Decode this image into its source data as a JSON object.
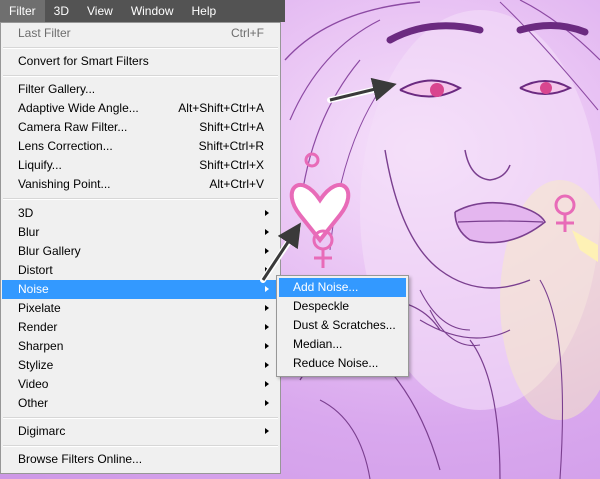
{
  "menubar": {
    "items": [
      "Filter",
      "3D",
      "View",
      "Window",
      "Help"
    ]
  },
  "filter_menu": {
    "last_filter": {
      "label": "Last Filter",
      "shortcut": "Ctrl+F"
    },
    "convert": "Convert for Smart Filters",
    "group1": [
      {
        "label": "Filter Gallery...",
        "shortcut": ""
      },
      {
        "label": "Adaptive Wide Angle...",
        "shortcut": "Alt+Shift+Ctrl+A"
      },
      {
        "label": "Camera Raw Filter...",
        "shortcut": "Shift+Ctrl+A"
      },
      {
        "label": "Lens Correction...",
        "shortcut": "Shift+Ctrl+R"
      },
      {
        "label": "Liquify...",
        "shortcut": "Shift+Ctrl+X"
      },
      {
        "label": "Vanishing Point...",
        "shortcut": "Alt+Ctrl+V"
      }
    ],
    "submenus": [
      "3D",
      "Blur",
      "Blur Gallery",
      "Distort",
      "Noise",
      "Pixelate",
      "Render",
      "Sharpen",
      "Stylize",
      "Video",
      "Other"
    ],
    "digimarc": "Digimarc",
    "browse": "Browse Filters Online..."
  },
  "noise_submenu": {
    "items": [
      "Add Noise...",
      "Despeckle",
      "Dust & Scratches...",
      "Median...",
      "Reduce Noise..."
    ]
  },
  "colors": {
    "menubar_bg": "#535353",
    "highlight": "#3399ff",
    "menu_bg": "#f0f0f0",
    "art_line": "#7a3f8f",
    "eye_magenta": "#d9468f"
  }
}
